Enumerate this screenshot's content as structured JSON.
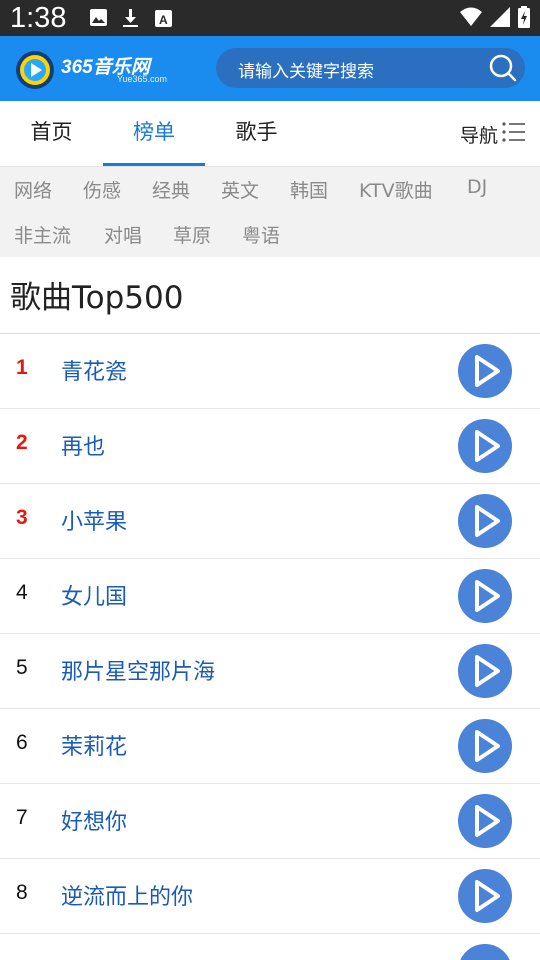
{
  "status_bar": {
    "time": "1:38",
    "icons": [
      "image-icon",
      "download-icon",
      "font-icon"
    ],
    "right_icons": [
      "wifi-icon",
      "signal-icon",
      "battery-charging-icon"
    ]
  },
  "header": {
    "logo_text": "365音乐网",
    "logo_sub": "Yue365.com",
    "search_placeholder": "请输入关键字搜索",
    "search_icon": "search-icon",
    "brand_color": "#1a8cf0"
  },
  "tabs": [
    {
      "label": "首页",
      "active": false
    },
    {
      "label": "榜单",
      "active": true
    },
    {
      "label": "歌手",
      "active": false
    }
  ],
  "nav_label": "导航",
  "categories": [
    "网络",
    "伤感",
    "经典",
    "英文",
    "韩国",
    "KTV歌曲",
    "DJ",
    "非主流",
    "对唱",
    "草原",
    "粤语"
  ],
  "section_title": "歌曲Top500",
  "songs": [
    {
      "rank": "1",
      "title": "青花瓷"
    },
    {
      "rank": "2",
      "title": "再也"
    },
    {
      "rank": "3",
      "title": "小苹果"
    },
    {
      "rank": "4",
      "title": "女儿国"
    },
    {
      "rank": "5",
      "title": "那片星空那片海"
    },
    {
      "rank": "6",
      "title": "茉莉花"
    },
    {
      "rank": "7",
      "title": "好想你"
    },
    {
      "rank": "8",
      "title": "逆流而上的你"
    }
  ],
  "colors": {
    "accent": "#1a7ad8",
    "top_rank": "#e8180c",
    "song_title": "#1a5bb8",
    "play_button": "#4a83d8"
  }
}
